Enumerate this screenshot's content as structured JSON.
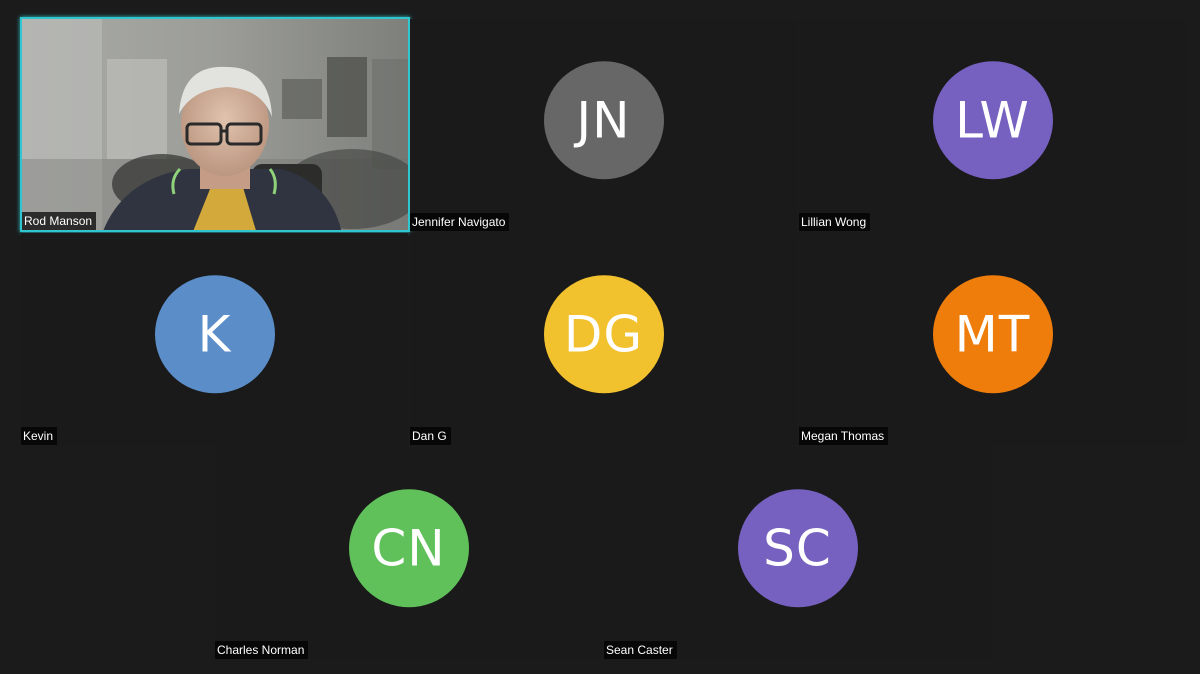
{
  "participants": [
    {
      "name": "Rod Manson",
      "initials": "",
      "color": "",
      "video": true,
      "active_speaker": true
    },
    {
      "name": "Jennifer Navigato",
      "initials": "JN",
      "color": "#676767",
      "video": false
    },
    {
      "name": "Lillian Wong",
      "initials": "LW",
      "color": "#7661c0",
      "video": false
    },
    {
      "name": "Kevin",
      "initials": "K",
      "color": "#5b8ec9",
      "video": false
    },
    {
      "name": "Dan G",
      "initials": "DG",
      "color": "#f2c12e",
      "video": false
    },
    {
      "name": "Megan Thomas",
      "initials": "MT",
      "color": "#ee7d0c",
      "video": false
    },
    {
      "name": "Charles Norman",
      "initials": "CN",
      "color": "#60c15a",
      "video": false
    },
    {
      "name": "Sean Caster",
      "initials": "SC",
      "color": "#7661c0",
      "video": false
    }
  ],
  "colors": {
    "background": "#1b1b1b",
    "tile": "#1a1a1a",
    "active_speaker_border": "#30c6cf"
  }
}
